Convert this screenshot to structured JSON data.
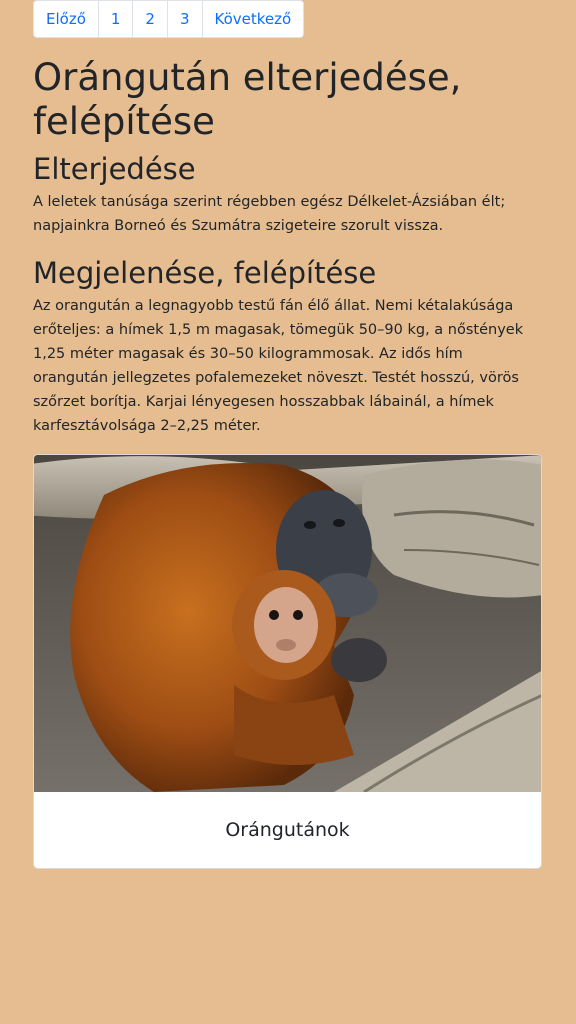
{
  "pagination": {
    "prev": "Előző",
    "pages": [
      "1",
      "2",
      "3"
    ],
    "next": "Következő"
  },
  "page": {
    "title": "Orángután elterjedése, felépítése"
  },
  "section_spread": {
    "heading": "Elterjedése",
    "text": "A leletek tanúsága szerint régebben egész Délkelet-Ázsiában élt; napjainkra Borneó és Szumátra szigeteire szorult vissza."
  },
  "section_appearance": {
    "heading": "Megjelenése, felépítése",
    "text": "Az orangután a legnagyobb testű fán élő állat. Nemi kétalakúsága erőteljes: a hímek 1,5 m magasak, tömegük 50–90 kg, a nőstények 1,25 méter magasak és 30–50 kilogrammosak. Az idős hím orangután jellegzetes pofalemezeket növeszt. Testét hosszú, vörös szőrzet borítja. Karjai lényegesen hosszabbak lábainál, a hímek karfesztávolsága 2–2,25 méter."
  },
  "card": {
    "caption": "Orángutánok"
  },
  "colors": {
    "background": "#e6bd90",
    "link": "#0d6efd"
  }
}
